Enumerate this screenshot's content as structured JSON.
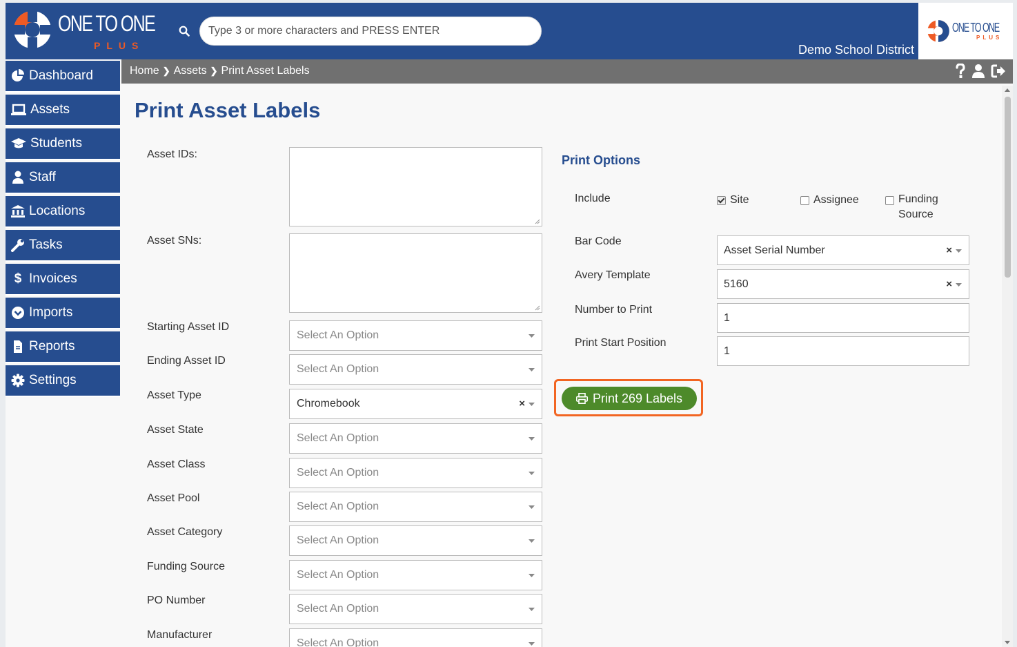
{
  "header": {
    "logo_text": "ONE TO ONE",
    "logo_sub": "PLUS",
    "search_placeholder": "Type 3 or more characters and PRESS ENTER",
    "district": "Demo School District",
    "colors": {
      "primary": "#264d8f",
      "accent": "#ee5a24"
    }
  },
  "breadcrumb": {
    "items": [
      "Home",
      "Assets",
      "Print Asset Labels"
    ],
    "icons": [
      "question-icon",
      "user-icon",
      "logout-icon"
    ]
  },
  "sidebar": {
    "items": [
      {
        "label": "Dashboard",
        "icon": "pie-chart-icon"
      },
      {
        "label": "Assets",
        "icon": "laptop-icon"
      },
      {
        "label": "Students",
        "icon": "graduation-cap-icon"
      },
      {
        "label": "Staff",
        "icon": "user-icon"
      },
      {
        "label": "Locations",
        "icon": "building-icon"
      },
      {
        "label": "Tasks",
        "icon": "wrench-icon"
      },
      {
        "label": "Invoices",
        "icon": "dollar-icon"
      },
      {
        "label": "Imports",
        "icon": "chevron-circle-icon"
      },
      {
        "label": "Reports",
        "icon": "file-icon"
      },
      {
        "label": "Settings",
        "icon": "gear-icon"
      }
    ]
  },
  "page": {
    "title": "Print Asset Labels"
  },
  "form": {
    "asset_ids_label": "Asset IDs:",
    "asset_sns_label": "Asset SNs:",
    "fields": [
      {
        "label": "Starting Asset ID",
        "value": "Select An Option",
        "placeholder": true
      },
      {
        "label": "Ending Asset ID",
        "value": "Select An Option",
        "placeholder": true
      },
      {
        "label": "Asset Type",
        "value": "Chromebook",
        "placeholder": false
      },
      {
        "label": "Asset State",
        "value": "Select An Option",
        "placeholder": true
      },
      {
        "label": "Asset Class",
        "value": "Select An Option",
        "placeholder": true
      },
      {
        "label": "Asset Pool",
        "value": "Select An Option",
        "placeholder": true
      },
      {
        "label": "Asset Category",
        "value": "Select An Option",
        "placeholder": true
      },
      {
        "label": "Funding Source",
        "value": "Select An Option",
        "placeholder": true
      },
      {
        "label": "PO Number",
        "value": "Select An Option",
        "placeholder": true
      },
      {
        "label": "Manufacturer",
        "value": "Select An Option",
        "placeholder": true
      }
    ]
  },
  "print_options": {
    "title": "Print Options",
    "include_label": "Include",
    "include": [
      {
        "label": "Site",
        "checked": true
      },
      {
        "label": "Assignee",
        "checked": false
      },
      {
        "label": "Funding Source",
        "checked": false
      }
    ],
    "bar_code_label": "Bar Code",
    "bar_code_value": "Asset Serial Number",
    "avery_label": "Avery Template",
    "avery_value": "5160",
    "number_label": "Number to Print",
    "number_value": "1",
    "start_label": "Print Start Position",
    "start_value": "1",
    "print_button": "Print 269 Labels",
    "button_color": "#4d8a2a",
    "highlight_color": "#f26522"
  }
}
